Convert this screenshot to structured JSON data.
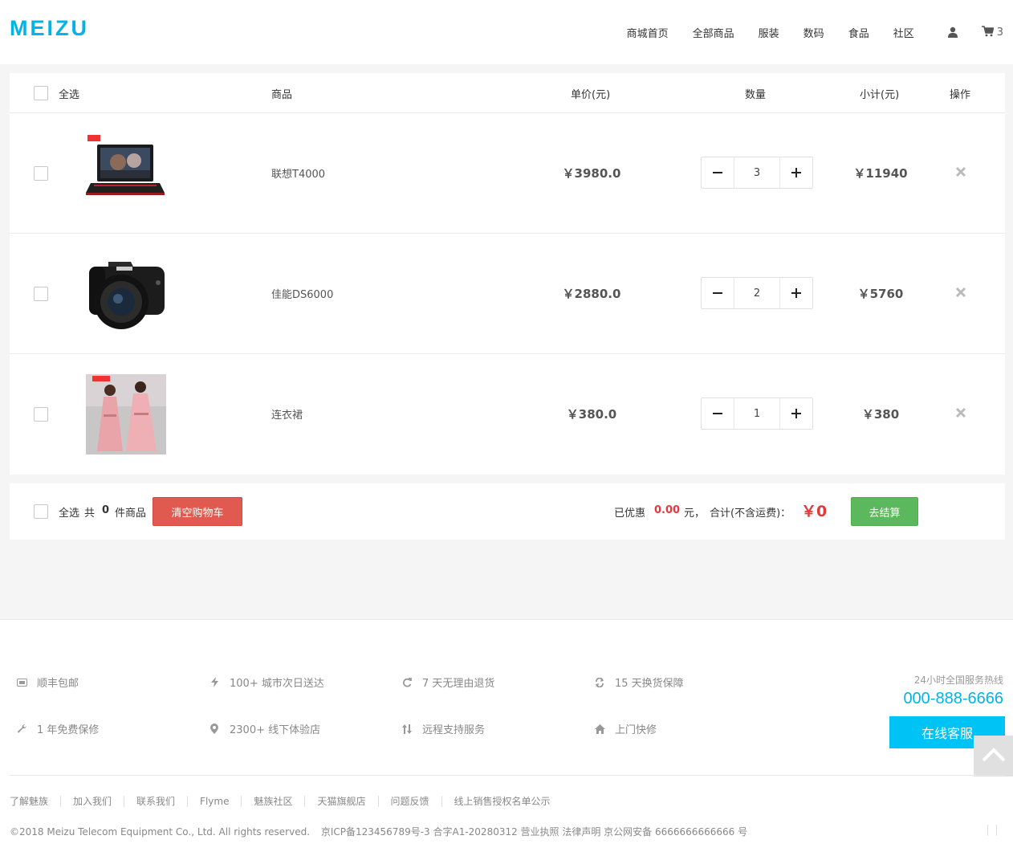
{
  "header": {
    "logo": "MEIZU",
    "nav": [
      "商城首页",
      "全部商品",
      "服装",
      "数码",
      "食品",
      "社区"
    ],
    "cart_count": "3"
  },
  "cart": {
    "columns": {
      "select_all": "全选",
      "product": "商品",
      "unit_price": "单价(元)",
      "quantity": "数量",
      "subtotal": "小计(元)",
      "action": "操作"
    },
    "items": [
      {
        "name": "联想T4000",
        "price": "￥3980.0",
        "qty": "3",
        "subtotal": "￥11940",
        "image": "laptop"
      },
      {
        "name": "佳能DS6000",
        "price": "￥2880.0",
        "qty": "2",
        "subtotal": "￥5760",
        "image": "camera"
      },
      {
        "name": "连衣裙",
        "price": "￥380.0",
        "qty": "1",
        "subtotal": "￥380",
        "image": "dress"
      }
    ],
    "footer": {
      "select_all": "全选",
      "total_prefix": "共",
      "count": "0",
      "total_suffix": "件商品",
      "clear_label": "清空购物车",
      "discount_label": "已优惠",
      "discount_value": "0.00",
      "discount_unit": "元，",
      "sum_label": "合计(不含运费)：",
      "sum_value": "￥0",
      "checkout_label": "去结算"
    }
  },
  "footer": {
    "services": [
      {
        "icon": "card-icon",
        "text": "顺丰包邮"
      },
      {
        "icon": "bolt-icon",
        "text": "100+ 城市次日送达"
      },
      {
        "icon": "refresh-icon",
        "text": "7 天无理由退货"
      },
      {
        "icon": "exchange-icon",
        "text": "15 天换货保障"
      },
      {
        "icon": "wrench-icon",
        "text": "1 年免费保修"
      },
      {
        "icon": "map-marker-icon",
        "text": "2300+ 线下体验店"
      },
      {
        "icon": "sort-icon",
        "text": "远程支持服务"
      },
      {
        "icon": "home-icon",
        "text": "上门快修"
      }
    ],
    "hotline_label": "24小时全国服务热线",
    "hotline_number": "000-888-6666",
    "service_button": "在线客服",
    "links": [
      "了解魅族",
      "加入我们",
      "联系我们",
      "Flyme",
      "魅族社区",
      "天猫旗舰店",
      "问题反馈",
      "线上销售授权名单公示"
    ],
    "copyright": [
      "©2018 Meizu Telecom Equipment Co., Ltd. All rights reserved.",
      "京ICP备123456789号-3 合字A1-20280312 营业执照 法律声明 京公网安备 6666666666666 号"
    ]
  },
  "colors": {
    "brand": "#00b4e8",
    "danger": "#e05a4f",
    "success": "#5cb85c",
    "price_red": "#e4393c"
  }
}
